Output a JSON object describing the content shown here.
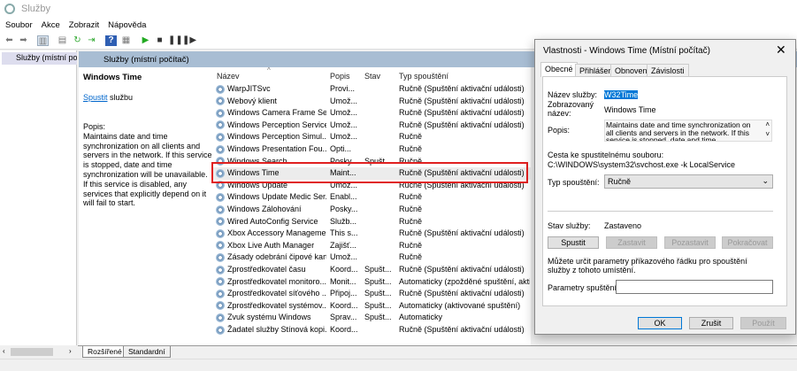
{
  "window": {
    "title": "Služby"
  },
  "menu": [
    "Soubor",
    "Akce",
    "Zobrazit",
    "Nápověda"
  ],
  "tree": {
    "root": "Služby (místní počítač)"
  },
  "header": {
    "title": "Služby (místní počítač)"
  },
  "description_panel": {
    "service_name": "Windows Time",
    "start_link": "Spustit",
    "start_suffix": " službu",
    "desc_label": "Popis:",
    "desc_text": "Maintains date and time synchronization on all clients and servers in the network. If this service is stopped, date and time synchronization will be unavailable. If this service is disabled, any services that explicitly depend on it will fail to start."
  },
  "columns": [
    "Název",
    "Popis",
    "Stav",
    "Typ spouštění"
  ],
  "services": [
    {
      "name": "WarpJITSvc",
      "desc": "Provi...",
      "status": "",
      "startup": "Ručně (Spuštění aktivační události)"
    },
    {
      "name": "Webový klient",
      "desc": "Umož...",
      "status": "",
      "startup": "Ručně (Spuštění aktivační události)"
    },
    {
      "name": "Windows Camera Frame Se...",
      "desc": "Umož...",
      "status": "",
      "startup": "Ručně (Spuštění aktivační události)"
    },
    {
      "name": "Windows Perception Service",
      "desc": "Umož...",
      "status": "",
      "startup": "Ručně (Spuštění aktivační události)"
    },
    {
      "name": "Windows Perception Simul...",
      "desc": "Umož...",
      "status": "",
      "startup": "Ručně"
    },
    {
      "name": "Windows Presentation Fou...",
      "desc": "Opti...",
      "status": "",
      "startup": "Ručně"
    },
    {
      "name": "Windows Search",
      "desc": "Posky...",
      "status": "Spušt...",
      "startup": "Ručně"
    },
    {
      "name": "Windows Time",
      "desc": "Maint...",
      "status": "",
      "startup": "Ručně (Spuštění aktivační události)",
      "selected": true
    },
    {
      "name": "Windows Update",
      "desc": "Umož...",
      "status": "",
      "startup": "Ručně (Spuštění aktivační události)"
    },
    {
      "name": "Windows Update Medic Ser...",
      "desc": "Enabl...",
      "status": "",
      "startup": "Ručně"
    },
    {
      "name": "Windows Zálohování",
      "desc": "Posky...",
      "status": "",
      "startup": "Ručně"
    },
    {
      "name": "Wired AutoConfig Service",
      "desc": "Služb...",
      "status": "",
      "startup": "Ručně"
    },
    {
      "name": "Xbox Accessory Manageme...",
      "desc": "This s...",
      "status": "",
      "startup": "Ručně (Spuštění aktivační události)"
    },
    {
      "name": "Xbox Live Auth Manager",
      "desc": "Zajišť...",
      "status": "",
      "startup": "Ručně"
    },
    {
      "name": "Zásady odebrání čipové karty",
      "desc": "Umož...",
      "status": "",
      "startup": "Ručně"
    },
    {
      "name": "Zprostředkovatel času",
      "desc": "Koord...",
      "status": "Spušt...",
      "startup": "Ručně (Spuštění aktivační události)"
    },
    {
      "name": "Zprostředkovatel monitoro...",
      "desc": "Monit...",
      "status": "Spušt...",
      "startup": "Automaticky (zpožděné spuštění, akti..."
    },
    {
      "name": "Zprostředkovatel síťového ...",
      "desc": "Připoj...",
      "status": "Spušt...",
      "startup": "Ručně (Spuštění aktivační události)"
    },
    {
      "name": "Zprostředkovatel systémov...",
      "desc": "Koord...",
      "status": "Spušt...",
      "startup": "Automaticky (aktivované spuštění)"
    },
    {
      "name": "Zvuk systému Windows",
      "desc": "Sprav...",
      "status": "Spušt...",
      "startup": "Automaticky"
    },
    {
      "name": "Žadatel služby Stínová kopi...",
      "desc": "Koord...",
      "status": "",
      "startup": "Ručně (Spuštění aktivační události)"
    }
  ],
  "bottom_tabs": [
    "Rozšířené",
    "Standardní"
  ],
  "dialog": {
    "title": "Vlastnosti - Windows Time (Místní počítač)",
    "tabs": [
      "Obecné",
      "Přihlášení",
      "Obnovení",
      "Závislosti"
    ],
    "service_name_label": "Název služby:",
    "service_name": "W32Time",
    "display_name_label": "Zobrazovaný název:",
    "display_name": "Windows Time",
    "desc_label": "Popis:",
    "desc": "Maintains date and time synchronization on all clients and servers in the network. If this service is stopped, date and time synchronization will be",
    "path_label": "Cesta ke spustitelnému souboru:",
    "path": "C:\\WINDOWS\\system32\\svchost.exe -k LocalService",
    "startup_label": "Typ spouštění:",
    "startup": "Ručně",
    "status_label": "Stav služby:",
    "status": "Zastaveno",
    "buttons": {
      "start": "Spustit",
      "stop": "Zastavit",
      "pause": "Pozastavit",
      "resume": "Pokračovat",
      "ok": "OK",
      "cancel": "Zrušit",
      "apply": "Použít"
    },
    "params_note": "Můžete určit parametry příkazového řádku pro spouštění služby z tohoto umístění.",
    "params_label": "Parametry spuštění:",
    "params_value": ""
  },
  "colors": {
    "highlight_box": "#e02020",
    "header": "#a8bdd3",
    "selection": "#0078d7"
  }
}
